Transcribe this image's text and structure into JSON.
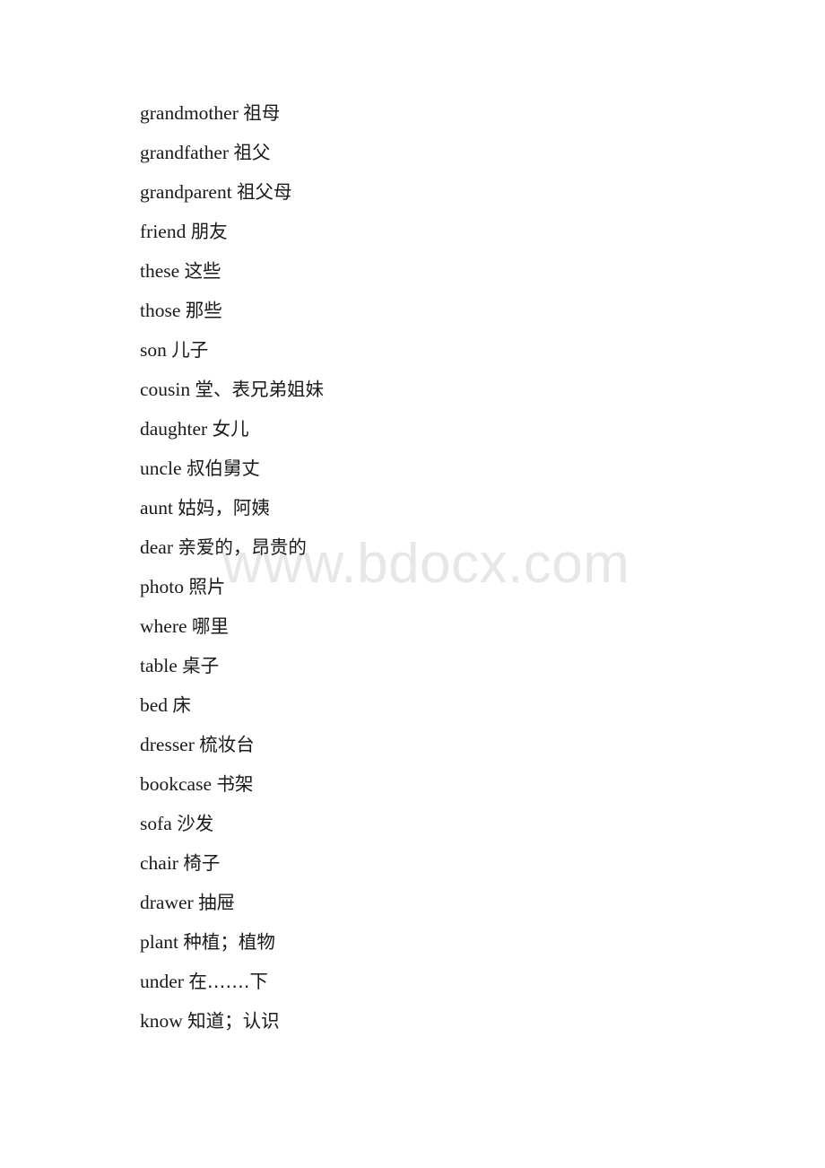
{
  "document": {
    "type": "vocabulary-list",
    "language_pair": "English-Chinese",
    "watermark": "www.bdocx.com",
    "entries": [
      {
        "term": "grandmother",
        "gloss": "祖母"
      },
      {
        "term": "grandfather",
        "gloss": "祖父"
      },
      {
        "term": "grandparent",
        "gloss": "祖父母"
      },
      {
        "term": "friend",
        "gloss": "朋友"
      },
      {
        "term": "these",
        "gloss": "这些"
      },
      {
        "term": "those",
        "gloss": "那些"
      },
      {
        "term": "son",
        "gloss": "儿子"
      },
      {
        "term": "cousin",
        "gloss": "堂、表兄弟姐妹"
      },
      {
        "term": "daughter",
        "gloss": "女儿"
      },
      {
        "term": "uncle",
        "gloss": "叔伯舅丈"
      },
      {
        "term": "aunt",
        "gloss": "姑妈，阿姨"
      },
      {
        "term": "dear",
        "gloss": "亲爱的，昂贵的"
      },
      {
        "term": "photo",
        "gloss": "照片"
      },
      {
        "term": "where",
        "gloss": "哪里"
      },
      {
        "term": "table",
        "gloss": "桌子"
      },
      {
        "term": "bed",
        "gloss": "床"
      },
      {
        "term": "dresser",
        "gloss": "梳妆台"
      },
      {
        "term": "bookcase",
        "gloss": "书架"
      },
      {
        "term": "sofa",
        "gloss": "沙发"
      },
      {
        "term": "chair",
        "gloss": "椅子"
      },
      {
        "term": "drawer",
        "gloss": "抽屉"
      },
      {
        "term": "plant",
        "gloss": "种植；植物"
      },
      {
        "term": "under",
        "gloss": "在…….下"
      },
      {
        "term": "know",
        "gloss": "知道；认识"
      }
    ]
  }
}
